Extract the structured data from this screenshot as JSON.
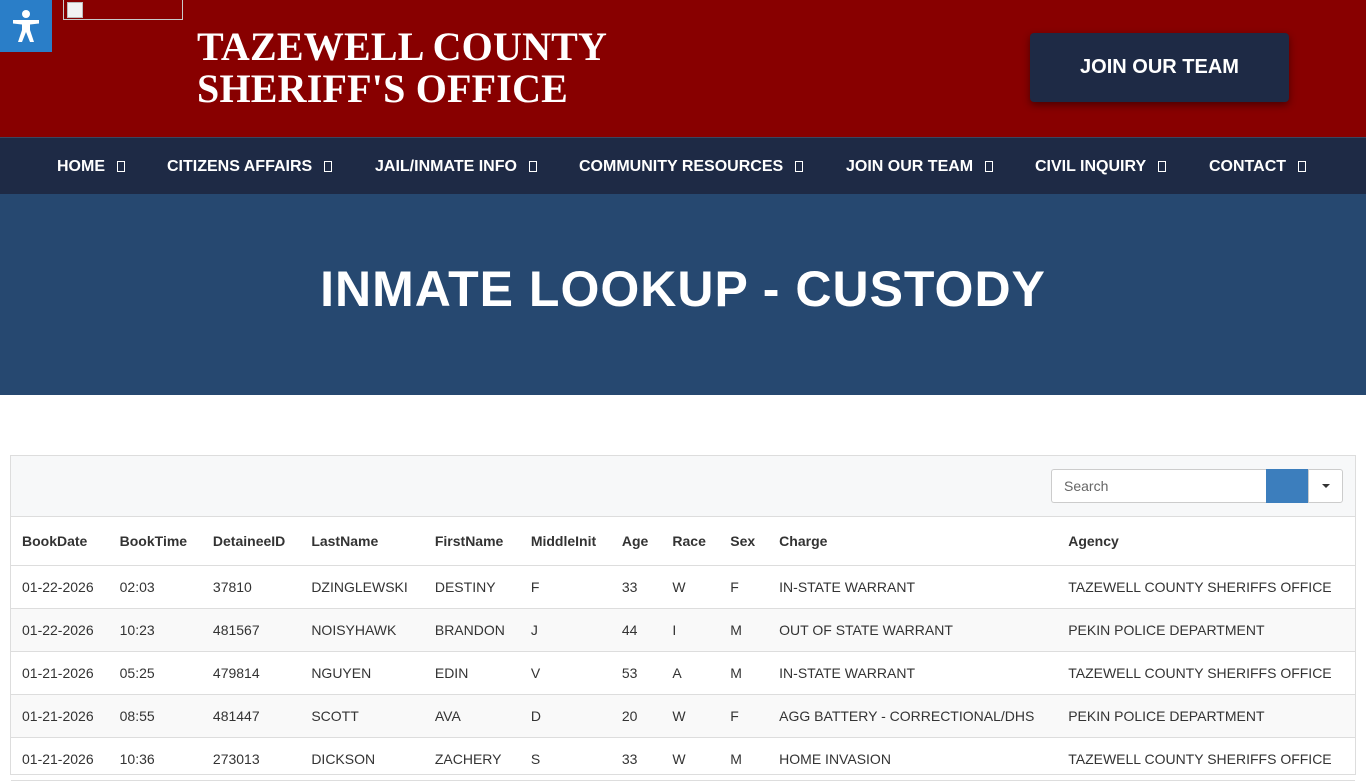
{
  "header": {
    "title_line1": "TAZEWELL COUNTY",
    "title_line2": "SHERIFF'S OFFICE",
    "join_button": "JOIN OUR TEAM"
  },
  "nav": {
    "items": [
      {
        "label": "HOME"
      },
      {
        "label": "CITIZENS AFFAIRS"
      },
      {
        "label": "JAIL/INMATE INFO"
      },
      {
        "label": "COMMUNITY RESOURCES"
      },
      {
        "label": "JOIN OUR TEAM"
      },
      {
        "label": "CIVIL INQUIRY"
      },
      {
        "label": "CONTACT"
      }
    ]
  },
  "hero": {
    "title": "INMATE LOOKUP - CUSTODY"
  },
  "toolbar": {
    "search_placeholder": "Search"
  },
  "table": {
    "columns": [
      "BookDate",
      "BookTime",
      "DetaineeID",
      "LastName",
      "FirstName",
      "MiddleInit",
      "Age",
      "Race",
      "Sex",
      "Charge",
      "Agency"
    ],
    "rows": [
      [
        "01-22-2026",
        "02:03",
        "37810",
        "DZINGLEWSKI",
        "DESTINY",
        "F",
        "33",
        "W",
        "F",
        "IN-STATE WARRANT",
        "TAZEWELL COUNTY SHERIFFS OFFICE"
      ],
      [
        "01-22-2026",
        "10:23",
        "481567",
        "NOISYHAWK",
        "BRANDON",
        "J",
        "44",
        "I",
        "M",
        "OUT OF STATE WARRANT",
        "PEKIN POLICE DEPARTMENT"
      ],
      [
        "01-21-2026",
        "05:25",
        "479814",
        "NGUYEN",
        "EDIN",
        "V",
        "53",
        "A",
        "M",
        "IN-STATE WARRANT",
        "TAZEWELL COUNTY SHERIFFS OFFICE"
      ],
      [
        "01-21-2026",
        "08:55",
        "481447",
        "SCOTT",
        "AVA",
        "D",
        "20",
        "W",
        "F",
        "AGG BATTERY - CORRECTIONAL/DHS",
        "PEKIN POLICE DEPARTMENT"
      ],
      [
        "01-21-2026",
        "10:36",
        "273013",
        "DICKSON",
        "ZACHERY",
        "S",
        "33",
        "W",
        "M",
        "HOME INVASION",
        "TAZEWELL COUNTY SHERIFFS OFFICE"
      ]
    ]
  },
  "icons": {
    "accessibility": "accessibility-icon",
    "nav_caret": "chevron-down-icon",
    "dropdown": "caret-down-icon"
  },
  "colors": {
    "header_bg": "#880000",
    "nav_bg": "#1e2a45",
    "hero_bg": "#264870",
    "search_button": "#3c7ebd"
  }
}
